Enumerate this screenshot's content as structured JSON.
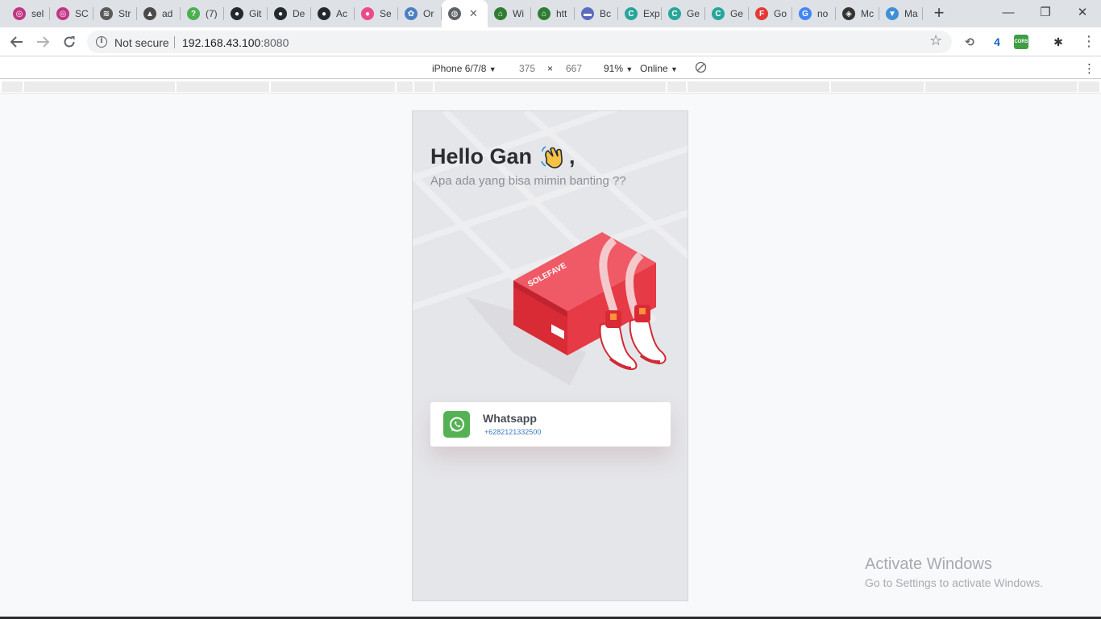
{
  "browser": {
    "tabs": [
      {
        "label": "sel",
        "color": "#c13584",
        "glyph": "◎"
      },
      {
        "label": "SC",
        "color": "#c13584",
        "glyph": "◎"
      },
      {
        "label": "Str",
        "color": "#5a5a5a",
        "glyph": "≋"
      },
      {
        "label": "ad",
        "color": "#4a4a4a",
        "glyph": "▲"
      },
      {
        "label": "(7)",
        "color": "#4caf50",
        "glyph": "?"
      },
      {
        "label": "Git",
        "color": "#24292e",
        "glyph": "●"
      },
      {
        "label": "De",
        "color": "#24292e",
        "glyph": "●"
      },
      {
        "label": "Ac",
        "color": "#24292e",
        "glyph": "●"
      },
      {
        "label": "Se",
        "color": "#ea4c89",
        "glyph": "●"
      },
      {
        "label": "Or",
        "color": "#4a7fc1",
        "glyph": "✿"
      }
    ],
    "active_tab": {
      "label": "",
      "close": "✕"
    },
    "tabs_right": [
      {
        "label": "Wi",
        "color": "#2e7d32",
        "glyph": "⌂"
      },
      {
        "label": "htt",
        "color": "#2e7d32",
        "glyph": "⌂"
      },
      {
        "label": "Bc",
        "color": "#5c6bc0",
        "glyph": "▬"
      },
      {
        "label": "Exp",
        "color": "#26a69a",
        "glyph": "C"
      },
      {
        "label": "Ge",
        "color": "#26a69a",
        "glyph": "C"
      },
      {
        "label": "Ge",
        "color": "#26a69a",
        "glyph": "C"
      },
      {
        "label": "Go",
        "color": "#e53935",
        "glyph": "F"
      },
      {
        "label": "no",
        "color": "#4285f4",
        "glyph": "G"
      },
      {
        "label": "Mc",
        "color": "#333333",
        "glyph": "◈"
      },
      {
        "label": "Ma",
        "color": "#3f8fd6",
        "glyph": "▼"
      }
    ],
    "newtab_label": "+",
    "window_controls": {
      "minimize": "—",
      "restore": "❐",
      "close": "✕"
    },
    "security_label": "Not secure",
    "url_host": "192.168.43.100",
    "url_port": ":8080",
    "extensions": [
      {
        "name": "sync-icon",
        "glyph": "⟲",
        "bg": "#ffffff",
        "fg": "#5f6368"
      },
      {
        "name": "extension-badge-icon",
        "glyph": "4",
        "bg": "#ffffff",
        "fg": "#1565c0"
      },
      {
        "name": "cors-icon",
        "glyph": "CORS",
        "bg": "#3f9d46",
        "fg": "#ffffff"
      },
      {
        "name": "spider-icon",
        "glyph": "✱",
        "bg": "#ffffff",
        "fg": "#333333"
      }
    ],
    "menu_glyph": "⋮"
  },
  "devtools": {
    "device": "iPhone 6/7/8",
    "width": "375",
    "times": "×",
    "height": "667",
    "zoom": "91%",
    "network": "Online",
    "caret": "▼"
  },
  "app": {
    "greeting": "Hello Gan",
    "greeting_suffix": ",",
    "subtitle": "Apa ada yang bisa mimin banting ??",
    "box_brand": "SOLEFAVE",
    "contact": {
      "name": "Whatsapp",
      "phone": "+6282121332500"
    }
  },
  "os_watermark": {
    "title": "Activate Windows",
    "subtitle": "Go to Settings to activate Windows."
  }
}
